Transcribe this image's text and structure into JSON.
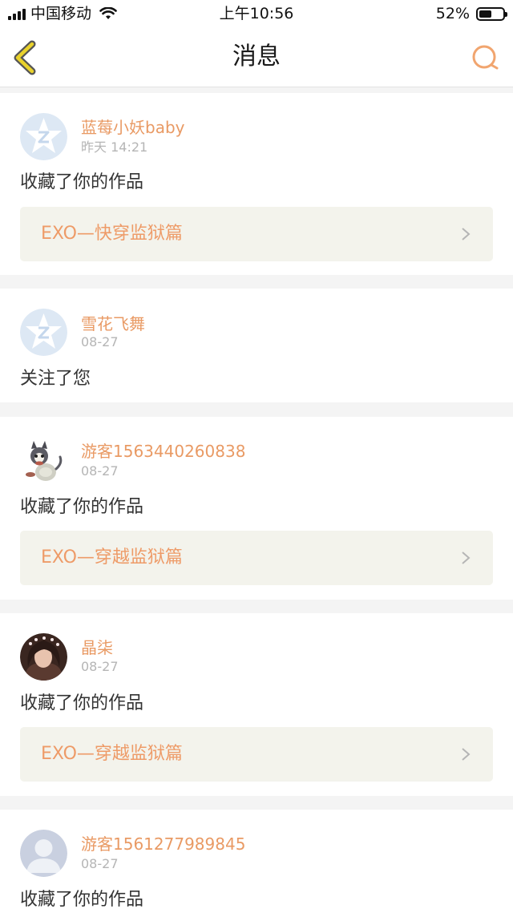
{
  "status_bar": {
    "carrier": "中国移动",
    "time": "上午10:56",
    "battery": "52%",
    "battery_level": 0.52
  },
  "nav": {
    "title": "消息",
    "back_icon": "back-chevron-icon",
    "search_icon": "search-icon"
  },
  "colors": {
    "accent": "#ee9b68",
    "username": "#e99a64",
    "timestamp": "#b5b5b5",
    "link_bg": "#f3f3ec",
    "back_icon": "#e9d22c",
    "separator": "#f4f4f4"
  },
  "messages": [
    {
      "username": "蓝莓小妖baby",
      "time": "昨天 14:21",
      "action": "收藏了你的作品",
      "work": "EXO—快穿监狱篇",
      "avatar": "qq-default-avatar"
    },
    {
      "username": "雪花飞舞",
      "time": "08-27",
      "action": "关注了您",
      "avatar": "qq-default-avatar"
    },
    {
      "username": "游客1563440260838",
      "time": "08-27",
      "action": "收藏了你的作品",
      "work": "EXO—穿越监狱篇",
      "avatar": "cat-avatar"
    },
    {
      "username": "晶柒",
      "time": "08-27",
      "action": "收藏了你的作品",
      "work": "EXO—穿越监狱篇",
      "avatar": "photo-avatar"
    },
    {
      "username": "游客1561277989845",
      "time": "08-27",
      "action": "收藏了你的作品",
      "avatar": "default-person-avatar"
    }
  ]
}
